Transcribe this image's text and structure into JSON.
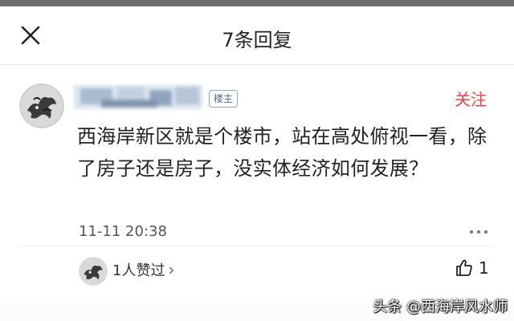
{
  "header": {
    "title": "7条回复",
    "close_icon": "close-icon"
  },
  "post": {
    "author_badge": "楼主",
    "follow_label": "关注",
    "content": "西海岸新区就是个楼市，站在高处俯视一看，除了房子还是房子，没实体经济如何发展？",
    "timestamp": "11-11 20:38",
    "more_icon": "more-dots-icon"
  },
  "likes": {
    "summary": "1人赞过",
    "chevron": "›",
    "count": "1",
    "icon": "thumbs-up-icon"
  },
  "watermark": "头条 @西海岸风水师",
  "colors": {
    "accent_red": "#f04142",
    "badge_blue": "#4e6d92",
    "top_strip": "#6f6f6f"
  }
}
